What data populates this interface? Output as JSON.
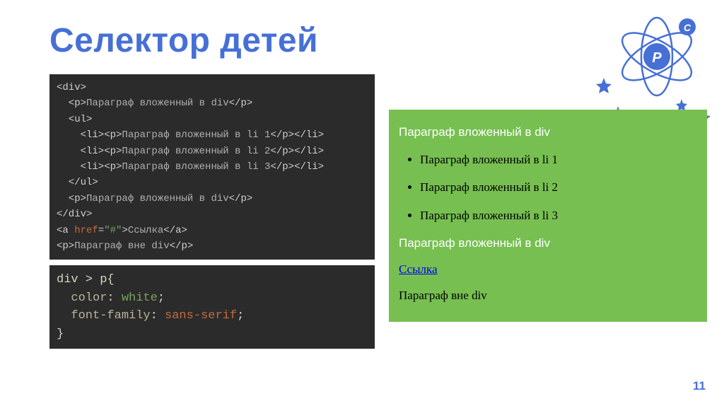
{
  "title": "Селектор детей",
  "pageNumber": "11",
  "logo": {
    "letterP": "P",
    "letterC": "C"
  },
  "htmlCode": {
    "l1": "<div>",
    "l2_open": "  <p>",
    "l2_text": "Параграф вложенный в div",
    "l2_close": "</p>",
    "l3": "  <ul>",
    "l4_open": "    <li><p>",
    "l4_text": "Параграф вложенный в li 1",
    "l4_close": "</p></li>",
    "l5_open": "    <li><p>",
    "l5_text": "Параграф вложенный в li 2",
    "l5_close": "</p></li>",
    "l6_open": "    <li><p>",
    "l6_text": "Параграф вложенный в li 3",
    "l6_close": "</p></li>",
    "l7": "  </ul>",
    "l8_open": "  <p>",
    "l8_text": "Параграф вложенный в div",
    "l8_close": "</p>",
    "l9": "</div>",
    "l10_a": "<a ",
    "l10_attr": "href",
    "l10_eq": "=",
    "l10_val": "\"#\"",
    "l10_b": ">",
    "l10_text": "Ссылка",
    "l10_close": "</a>",
    "l11_open": "<p>",
    "l11_text": "Параграф вне div",
    "l11_close": "</p>"
  },
  "cssCode": {
    "selector": "div > p",
    "brace_open": "{",
    "prop1": "color",
    "colon": ": ",
    "val1": "white",
    "semi": ";",
    "prop2": "font-family",
    "val2": "sans-serif",
    "brace_close": "}"
  },
  "render": {
    "p1": "Параграф вложенный в div",
    "li1": "Параграф вложенный в li 1",
    "li2": "Параграф вложенный в li 2",
    "li3": "Параграф вложенный в li 3",
    "p2": "Параграф вложенный в div",
    "link": "Ссылка",
    "p3": "Параграф вне div"
  }
}
